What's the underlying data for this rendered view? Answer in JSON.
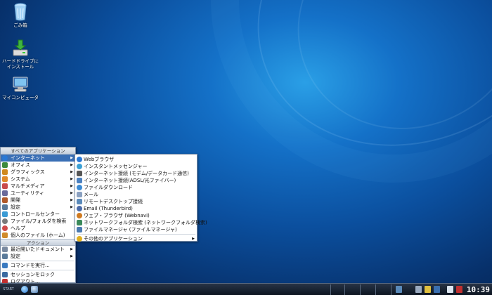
{
  "desktop_icons": [
    {
      "label": "ごみ箱",
      "icon": "trash-icon"
    },
    {
      "label": "ハードドライブに\nインストール",
      "icon": "install-icon"
    },
    {
      "label": "マイコンピュータ",
      "icon": "computer-icon"
    }
  ],
  "start_menu": {
    "header": "すべてのアプリケーション",
    "apps": [
      {
        "label": "インターネット",
        "arrow": true,
        "icon": "globe-icon",
        "color": "#2a78d4",
        "selected": true
      },
      {
        "label": "オフィス",
        "arrow": true,
        "icon": "office-icon",
        "color": "#3d8a3d"
      },
      {
        "label": "グラフィックス",
        "arrow": true,
        "icon": "graphics-icon",
        "color": "#d08a20"
      },
      {
        "label": "システム",
        "arrow": true,
        "icon": "system-icon",
        "color": "#e08a2a"
      },
      {
        "label": "マルチメディア",
        "arrow": true,
        "icon": "multimedia-icon",
        "color": "#c94a4a"
      },
      {
        "label": "ユーティリティ",
        "arrow": true,
        "icon": "utility-icon",
        "color": "#6a6a9a"
      },
      {
        "label": "開発",
        "arrow": true,
        "icon": "development-icon",
        "color": "#b05a2a"
      },
      {
        "label": "設定",
        "arrow": true,
        "icon": "settings-icon",
        "color": "#5a7a9a"
      },
      {
        "label": "コントロールセンター",
        "arrow": false,
        "icon": "control-center-icon",
        "color": "#3a9ad4"
      },
      {
        "label": "ファイル/フォルダを検索",
        "arrow": false,
        "icon": "search-icon",
        "color": "#7a7a7a"
      },
      {
        "label": "ヘルプ",
        "arrow": false,
        "icon": "help-icon",
        "color": "#d04a4a"
      },
      {
        "label": "個人のファイル (ホーム)",
        "arrow": false,
        "icon": "home-icon",
        "color": "#d08a2a"
      }
    ],
    "actions_header": "アクション",
    "actions": [
      {
        "label": "最近開いたドキュメント",
        "arrow": true,
        "icon": "recent-icon",
        "color": "#7a8aa0"
      },
      {
        "label": "設定",
        "arrow": true,
        "icon": "settings-icon",
        "color": "#5a7a9a"
      },
      {
        "label": "コマンドを実行...",
        "arrow": false,
        "icon": "run-icon",
        "color": "#3a7ac0"
      },
      {
        "label": "セッションをロック",
        "arrow": false,
        "icon": "lock-icon",
        "color": "#3a6aa0"
      },
      {
        "label": "ログアウト...",
        "arrow": false,
        "icon": "logout-icon",
        "color": "#c03030"
      }
    ]
  },
  "submenu": {
    "items": [
      {
        "label": "Webブラウザ",
        "icon": "web-browser-icon",
        "color": "#2a78d4"
      },
      {
        "label": "インスタントメッセンジャー",
        "icon": "messenger-icon",
        "color": "#3aa0d4"
      },
      {
        "label": "インターネット接続 (モデム/データカード通信)",
        "icon": "modem-icon",
        "color": "#555555"
      },
      {
        "label": "インターネット接続(ADSL/光ファイバー)",
        "icon": "network-icon",
        "color": "#4a80c0"
      },
      {
        "label": "ファイルダウンロード",
        "icon": "download-icon",
        "color": "#3a8ad4"
      },
      {
        "label": "メール",
        "icon": "mail-icon",
        "color": "#8aa0c0"
      },
      {
        "label": "リモートデスクトップ接続",
        "icon": "remote-desktop-icon",
        "color": "#5a8aba"
      },
      {
        "label": "Email (Thunderbird)",
        "icon": "thunderbird-icon",
        "color": "#4a6aa8"
      },
      {
        "label": "ウェブ・ブラウザ (Webnavi)",
        "icon": "webnavi-icon",
        "color": "#d07a20"
      },
      {
        "label": "ネットワークフォルダ検索 (ネットワークフォルダ検索)",
        "icon": "network-folder-icon",
        "color": "#3a8a5a"
      },
      {
        "label": "ファイルマネージャ (ファイルマネージャ)",
        "icon": "file-manager-icon",
        "color": "#4a7ab0"
      },
      {
        "label": "その他のアプリケーション",
        "icon": "other-apps-icon",
        "color": "#e0b020",
        "arrow": true
      }
    ]
  },
  "taskbar": {
    "start_label": "START",
    "clock": "10:39"
  }
}
